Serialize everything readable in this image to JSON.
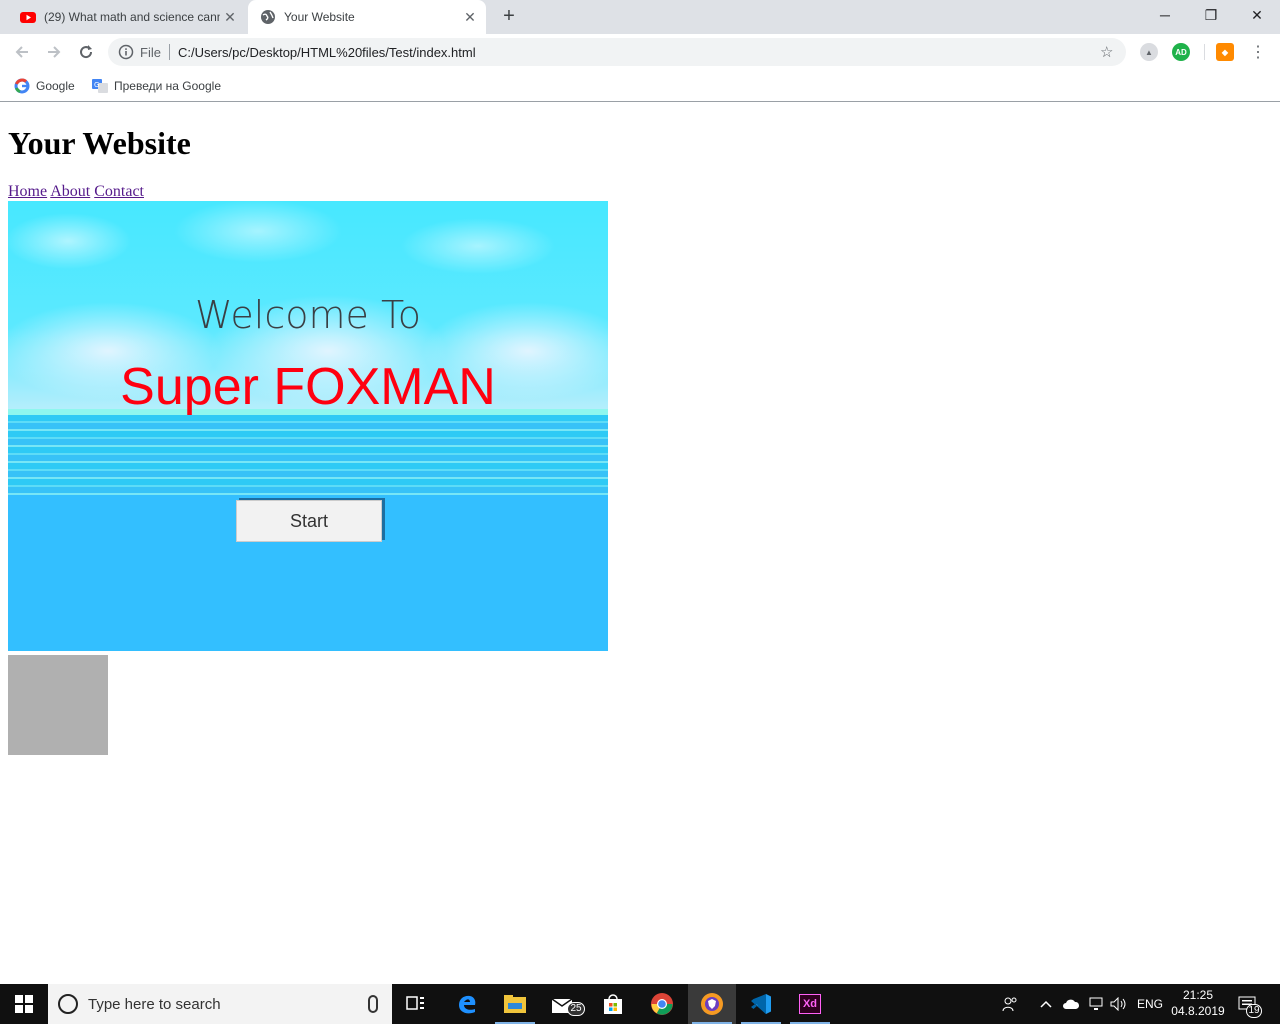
{
  "browser": {
    "tabs": [
      {
        "title": "(29) What math and science cann",
        "active": false,
        "icon": "youtube-icon"
      },
      {
        "title": "Your Website",
        "active": true,
        "icon": "globe-icon"
      }
    ],
    "address": {
      "scheme_label": "File",
      "url": "C:/Users/pc/Desktop/HTML%20files/Test/index.html"
    },
    "bookmarks": [
      "Google",
      "Преведи на Google"
    ],
    "extension_badge": "AD"
  },
  "page": {
    "heading": "Your Website",
    "nav": [
      "Home",
      "About",
      "Contact"
    ],
    "game": {
      "welcome": "Welcome To",
      "title": "Super FOXMAN",
      "start_label": "Start"
    }
  },
  "taskbar": {
    "search_placeholder": "Type here to search",
    "mail_badge": "25",
    "lang": "ENG",
    "time": "21:25",
    "date": "04.8.2019",
    "notification_count": "19"
  }
}
